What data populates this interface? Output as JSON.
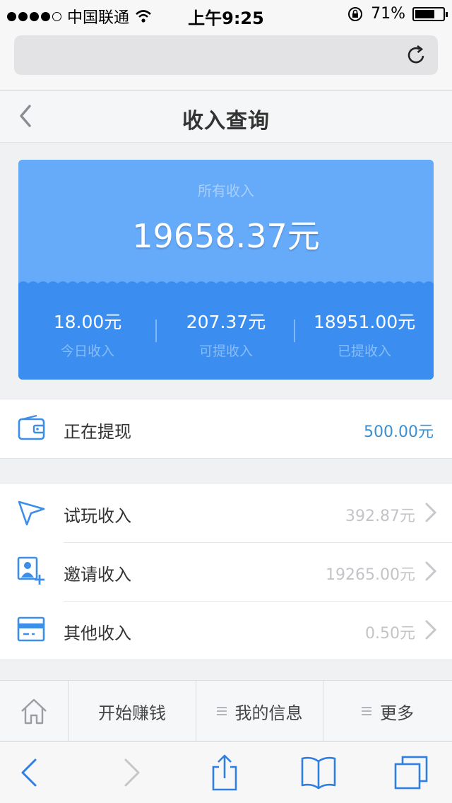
{
  "status_bar": {
    "carrier": "中国联通",
    "time": "上午9:25",
    "battery": "71%",
    "battery_level": 0.71
  },
  "nav": {
    "title": "收入查询"
  },
  "summary": {
    "total_label": "所有收入",
    "total_value": "19658.37元",
    "stats": [
      {
        "value": "18.00元",
        "label": "今日收入"
      },
      {
        "value": "207.37元",
        "label": "可提收入"
      },
      {
        "value": "18951.00元",
        "label": "已提收入"
      }
    ]
  },
  "withdrawing": {
    "label": "正在提现",
    "value": "500.00元",
    "icon": "wallet-icon"
  },
  "income_items": [
    {
      "label": "试玩收入",
      "value": "392.87元",
      "icon": "paper-plane-icon"
    },
    {
      "label": "邀请收入",
      "value": "19265.00元",
      "icon": "add-user-icon"
    },
    {
      "label": "其他收入",
      "value": "0.50元",
      "icon": "card-icon"
    }
  ],
  "tab_menu": {
    "home_icon": "home-icon",
    "start": "开始赚钱",
    "my_info": "我的信息",
    "more": "更多"
  },
  "colors": {
    "card_top": "#66aafa",
    "card_bottom": "#3b8eef",
    "accent_blue": "#3b8fd0",
    "icon_blue": "#3d8ee8"
  }
}
